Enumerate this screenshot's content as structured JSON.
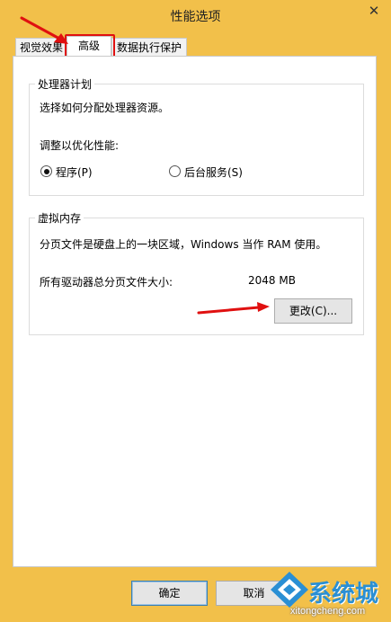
{
  "window": {
    "title": "性能选项",
    "close_glyph": "✕"
  },
  "tabs": [
    {
      "label": "视觉效果"
    },
    {
      "label": "高级"
    },
    {
      "label": "数据执行保护"
    }
  ],
  "processor": {
    "group_title": "处理器计划",
    "description": "选择如何分配处理器资源。",
    "adjust_label": "调整以优化性能:",
    "options": [
      {
        "label": "程序(P)",
        "checked": true
      },
      {
        "label": "后台服务(S)",
        "checked": false
      }
    ]
  },
  "virtual_memory": {
    "group_title": "虚拟内存",
    "description": "分页文件是硬盘上的一块区域，Windows 当作 RAM 使用。",
    "total_label": "所有驱动器总分页文件大小:",
    "total_value": "2048 MB",
    "change_button": "更改(C)..."
  },
  "footer": {
    "ok_label": "确定",
    "cancel_label": "取消"
  },
  "watermark": {
    "brand": "系统城",
    "url": "xitongcheng.com"
  },
  "colors": {
    "frame": "#f2c04a",
    "annotation_red": "#e01010",
    "watermark_blue": "#2a8fd4"
  }
}
